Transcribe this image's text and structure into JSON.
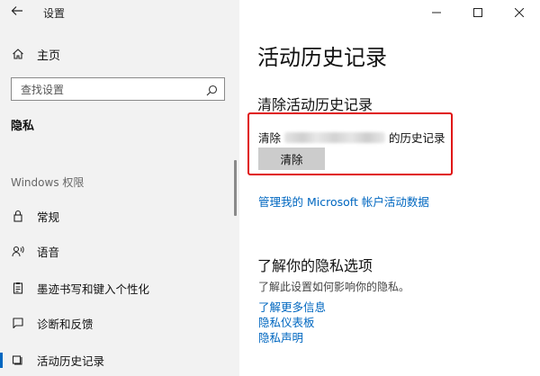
{
  "app": {
    "title": "设置"
  },
  "window_controls": {
    "minimize": "—",
    "maximize": "☐",
    "close": "✕"
  },
  "sidebar": {
    "home_label": "主页",
    "search_placeholder": "查找设置",
    "category_heading": "隐私",
    "section_label": "Windows 权限",
    "items": [
      {
        "label": "常规",
        "icon": "lock-icon"
      },
      {
        "label": "语音",
        "icon": "speech-icon"
      },
      {
        "label": "墨迹书写和键入个性化",
        "icon": "clipboard-icon"
      },
      {
        "label": "诊断和反馈",
        "icon": "feedback-icon"
      },
      {
        "label": "活动历史记录",
        "icon": "activity-icon",
        "selected": true
      }
    ]
  },
  "main": {
    "title": "活动历史记录",
    "clear_section": {
      "heading": "清除活动历史记录",
      "prefix": "清除",
      "suffix": "的历史记录",
      "button_label": "清除"
    },
    "manage_link": "管理我的 Microsoft 帐户活动数据",
    "privacy_section": {
      "heading": "了解你的隐私选项",
      "description": "了解此设置如何影响你的隐私。",
      "links": [
        "了解更多信息",
        "隐私仪表板",
        "隐私声明"
      ]
    }
  },
  "colors": {
    "accent": "#0067c0",
    "highlight": "#e01010",
    "sidebar_bg": "#f2f2f2"
  }
}
